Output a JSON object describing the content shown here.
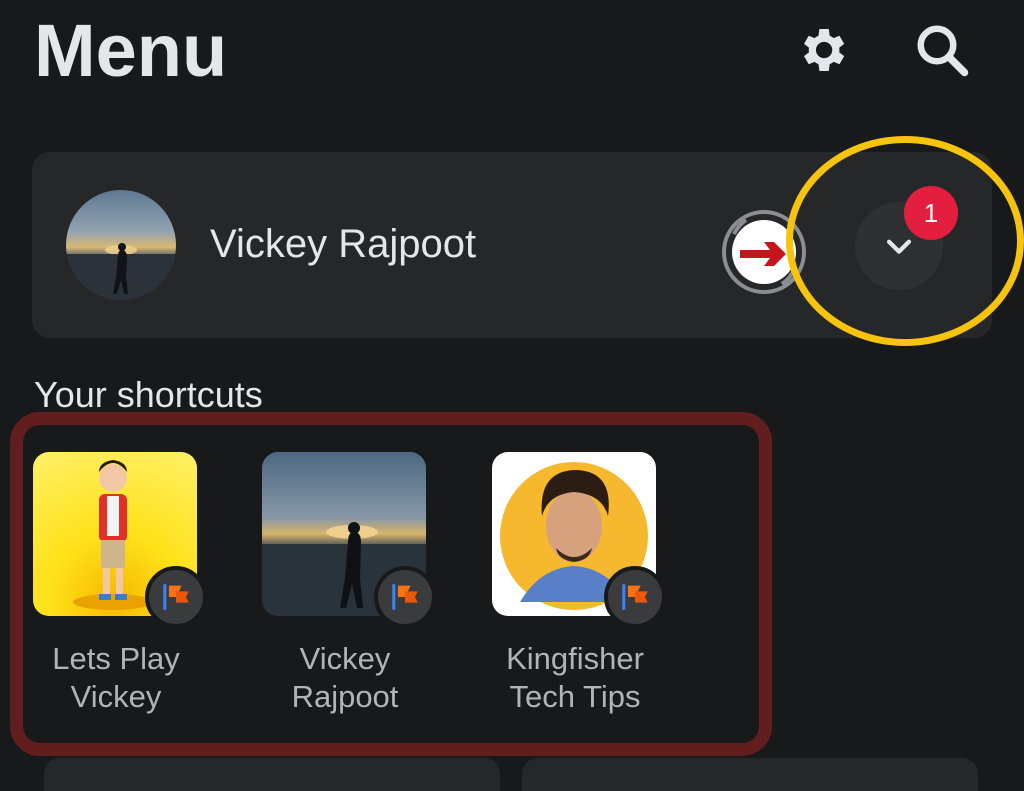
{
  "header": {
    "title": "Menu",
    "settings_icon": "gear-icon",
    "search_icon": "search-icon"
  },
  "profile": {
    "name": "Vickey Rajpoot",
    "switch_icon": "switch-profile-icon",
    "expand_icon": "chevron-down-icon",
    "notification_count": "1"
  },
  "shortcuts": {
    "title": "Your shortcuts",
    "items": [
      {
        "line1": "Lets Play",
        "line2": "Vickey",
        "icon": "page-flag-icon"
      },
      {
        "line1": "Vickey",
        "line2": "Rajpoot",
        "icon": "page-flag-icon"
      },
      {
        "line1": "Kingfisher",
        "line2": "Tech Tips",
        "icon": "page-flag-icon"
      }
    ]
  },
  "colors": {
    "background": "#18191a",
    "card": "#262729",
    "badge": "#e41e3f",
    "highlight_ring": "#f6c40c",
    "highlight_frame": "#621d1e"
  }
}
